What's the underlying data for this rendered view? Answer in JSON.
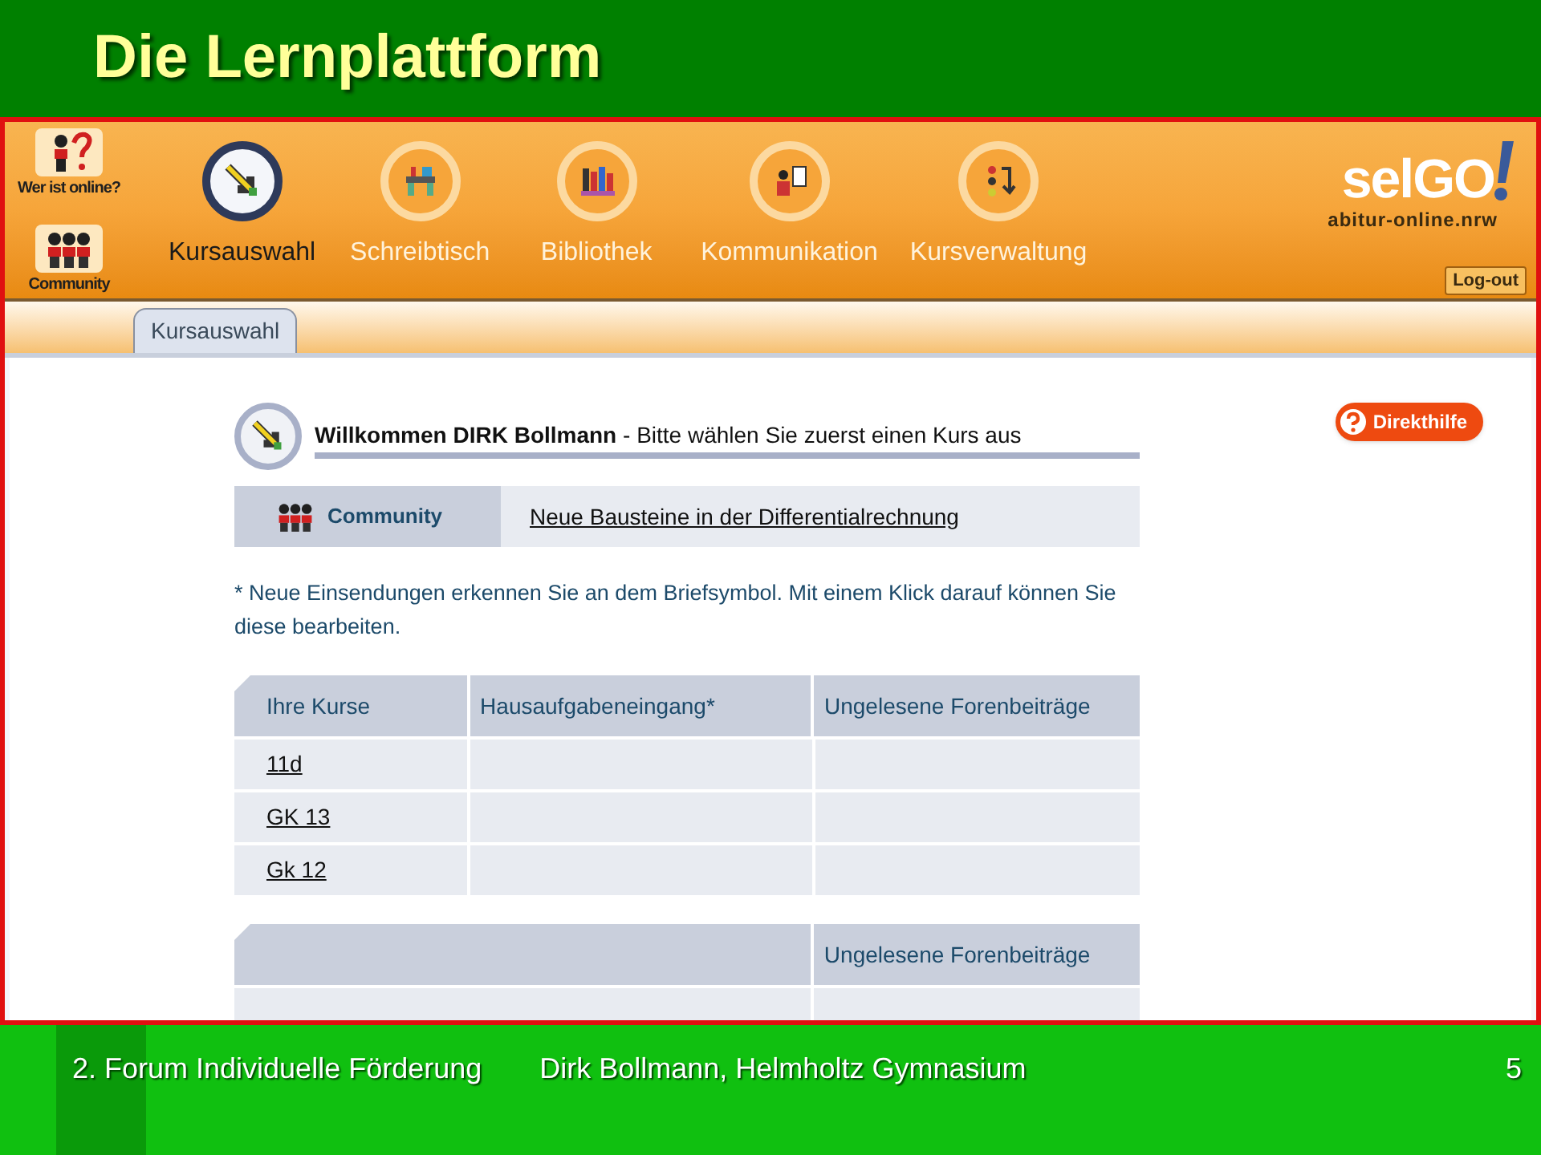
{
  "slide": {
    "title": "Die Lernplattform",
    "footer": {
      "left": "2. Forum Individuelle Förderung",
      "center": "Dirk Bollmann, Helmholtz Gymnasium",
      "page_number": "5"
    }
  },
  "app": {
    "quick_links": [
      {
        "label": "Wer ist online?"
      },
      {
        "label": "Community"
      }
    ],
    "nav": [
      {
        "label": "Kursauswahl",
        "selected": true
      },
      {
        "label": "Schreibtisch",
        "selected": false
      },
      {
        "label": "Bibliothek",
        "selected": false
      },
      {
        "label": "Kommunikation",
        "selected": false
      },
      {
        "label": "Kursverwaltung",
        "selected": false
      }
    ],
    "logo": {
      "name": "selGO",
      "tagline": "abitur-online.nrw"
    },
    "logout": "Log-out",
    "tabs": [
      {
        "label": "Kursauswahl",
        "selected": true
      }
    ],
    "welcome": "**Willkommen DIRK Bollmann** - Bitte wählen Sie zuerst einen Kurs aus",
    "help_button": "Direkthilfe",
    "community": {
      "label": "Community",
      "link": "Neue Bausteine in der Differentialrechnung"
    },
    "note": "* Neue Einsendungen erkennen Sie an dem Briefsymbol. Mit einem Klick darauf können Sie diese bearbeiten.",
    "courses_table": {
      "columns": [
        "Ihre Kurse",
        "Hausaufgabeneingang*",
        "Ungelesene Forenbeiträge"
      ],
      "rows": [
        {
          "course": "11d"
        },
        {
          "course": "GK 13"
        },
        {
          "course": "Gk 12"
        }
      ]
    },
    "second_table": {
      "column_3": "Ungelesene Forenbeiträge"
    }
  }
}
